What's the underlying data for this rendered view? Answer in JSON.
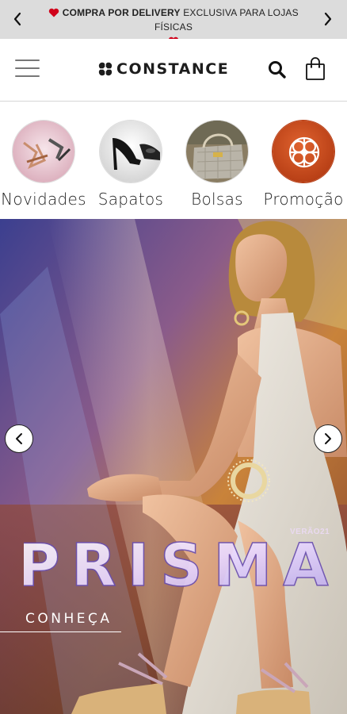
{
  "announcement": {
    "bold_text": "COMPRA POR DELIVERY",
    "text": " EXCLUSIVA PARA LOJAS FÍSICAS",
    "prev_icon": "chevron-left-icon",
    "next_icon": "chevron-right-icon",
    "heart_color": "#d0021b"
  },
  "header": {
    "logo": "CONSTANCE",
    "menu_icon": "hamburger-menu-icon",
    "search_icon": "search-icon",
    "bag_icon": "shopping-bag-icon"
  },
  "categories": [
    {
      "label": "Novidades"
    },
    {
      "label": "Sapatos"
    },
    {
      "label": "Bolsas"
    },
    {
      "label": "Promoção"
    }
  ],
  "banner": {
    "title": "PRISMA",
    "season": "VERÃO21",
    "cta": "CONHEÇA",
    "prev_icon": "chevron-left-icon",
    "next_icon": "chevron-right-icon"
  },
  "colors": {
    "announce_bg": "#dcdcdc",
    "promo_orange": "#c8481c"
  }
}
